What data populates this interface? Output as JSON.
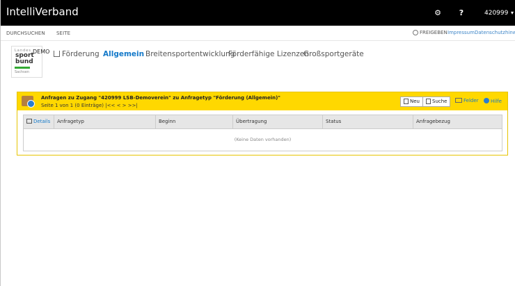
{
  "app": {
    "title": "IntelliVerband"
  },
  "topbar": {
    "gear_symbol": "⚙",
    "help_symbol": "?",
    "user": "420999",
    "caret": "▾"
  },
  "subnav": {
    "browse": "DURCHSUCHEN",
    "page": "SEITE",
    "share": "FREIGEBEN",
    "impressum": "Impressum",
    "privacy": "Datenschutzhinwe"
  },
  "logo": {
    "line1": "Landes",
    "line2": "sport",
    "line3": "bund",
    "line4": "Sachsen",
    "demo": "DEMO"
  },
  "tabs": [
    {
      "label": "Förderung",
      "icon": "document-icon"
    },
    {
      "label": "Allgemein",
      "active": true
    },
    {
      "label": "Breitensportentwicklung"
    },
    {
      "label": "Förderfähige Lizenzen"
    },
    {
      "label": "Großsportgeräte"
    }
  ],
  "panel": {
    "title": "Anfragen zu Zugang \"420999 LSB-Demoverein\" zu Anfragetyp \"Förderung (Allgemein)\"",
    "info_page": "Seite 1 von 1 (0 Einträge)",
    "info_nav": "|<< < > >>|",
    "btn_new": "Neu",
    "btn_search": "Suche",
    "link_fields": "Felder",
    "link_help": "Hilfe"
  },
  "table": {
    "columns": [
      "Details",
      "Anfragetyp",
      "Beginn",
      "Übertragung",
      "Status",
      "Anfragebezug"
    ],
    "empty_text": "(Keine Daten vorhanden)"
  },
  "colors": {
    "header_bg": "#000000",
    "panel_yellow": "#ffd800",
    "link_blue": "#1479c9"
  }
}
